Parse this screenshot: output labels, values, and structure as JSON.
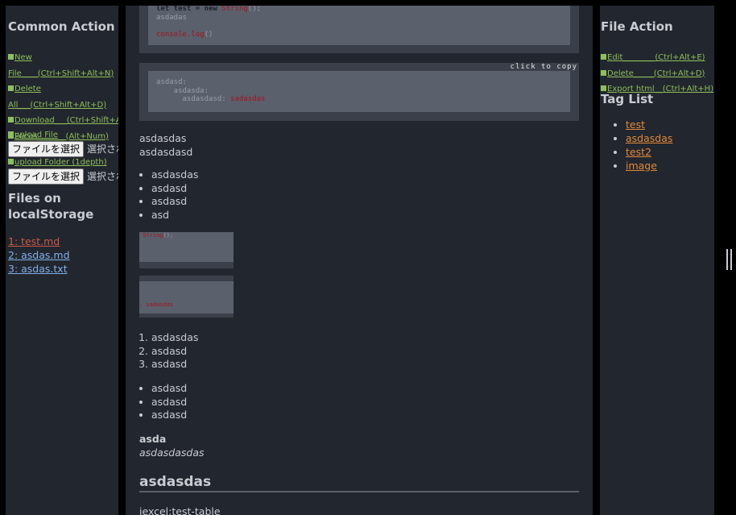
{
  "left": {
    "common_title": "Common Action",
    "actions": [
      {
        "line1": "New",
        "line2": "File____(Ctrl+Shift+Alt+N)"
      },
      {
        "line1": "Delete",
        "line2": "All___(Ctrl+Shift+Alt+D)"
      },
      {
        "line1": "Download___(Ctrl+Shift+Alt"
      },
      {
        "line1": "Focus_______(Alt+Num)"
      }
    ],
    "upload_file": {
      "label": "upload File",
      "button": "ファイルを選択",
      "status": "選択されてい"
    },
    "upload_folder": {
      "label": "upload Folder (1depth)",
      "button": "ファイルを選択",
      "status": "選択されてい"
    },
    "storage_title_1": "Files on",
    "storage_title_2": "localStorage",
    "files": [
      {
        "label": "1: test.md",
        "color": "#c85a4a"
      },
      {
        "label": "2: asdas.md",
        "color": "#7fb0e8"
      },
      {
        "label": "3: asdas.txt",
        "color": "#7fb0e8"
      }
    ]
  },
  "center": {
    "code1": {
      "line1_a": "let test = new ",
      "line1_b": "String",
      "line1_c": "();",
      "line2": "asdadas",
      "line4_a": "console.",
      "line4_b": "log",
      "line4_c": "()"
    },
    "code2": {
      "copy": "click to copy",
      "line1": "asdasd:",
      "line2": "    asdasda:",
      "line3_a": "      asdasdasd: ",
      "line3_b": "sadasdas"
    },
    "para1": "asdasdas",
    "para2": "asdasdasd",
    "list1": [
      "asdasdas",
      "asdasd",
      "asdasd",
      "asd"
    ],
    "box1": {
      "a": " Str",
      "b": "ing",
      "c": "();"
    },
    "box2": {
      "text": ": sadasdas"
    },
    "olist": [
      "asdasdas",
      "asdasd",
      "asdasd"
    ],
    "list2": [
      "asdasd",
      "asdasd",
      "asdasd"
    ],
    "bold": "asda",
    "italic": "asdasdasdas",
    "heading": "asdasdas",
    "last": "jexcel:test-table"
  },
  "right": {
    "file_title": "File Action",
    "actions": [
      "Edit________(Ctrl+Alt+E)",
      "Delete_____(Ctrl+Alt+D)",
      "Export html__(Ctrl+Alt+H)"
    ],
    "tag_title": "Tag List",
    "tags": [
      "test",
      "asdasdas",
      "test2",
      "image"
    ]
  }
}
